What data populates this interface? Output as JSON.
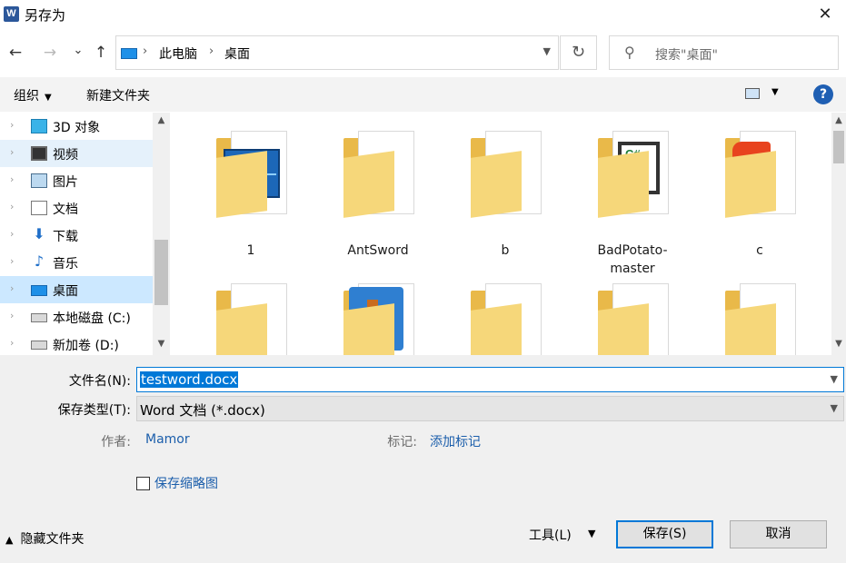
{
  "window": {
    "title": "另存为",
    "app_icon": "word-icon",
    "close": "✕"
  },
  "nav": {
    "back": "←",
    "forward": "→",
    "recent": "⌄",
    "up": "↑",
    "breadcrumb": [
      "此电脑",
      "桌面"
    ],
    "refresh": "↻",
    "search_placeholder": "搜索\"桌面\""
  },
  "toolbar": {
    "organize": "组织",
    "new_folder": "新建文件夹",
    "help": "?"
  },
  "tree": [
    {
      "label": "3D 对象",
      "icon": "cube-3d-icon",
      "state": ""
    },
    {
      "label": "视频",
      "icon": "video-icon",
      "state": "hover"
    },
    {
      "label": "图片",
      "icon": "pictures-icon",
      "state": ""
    },
    {
      "label": "文档",
      "icon": "documents-icon",
      "state": ""
    },
    {
      "label": "下载",
      "icon": "download-icon",
      "state": ""
    },
    {
      "label": "音乐",
      "icon": "music-icon",
      "state": ""
    },
    {
      "label": "桌面",
      "icon": "desktop-icon",
      "state": "sel"
    },
    {
      "label": "本地磁盘 (C:)",
      "icon": "drive-c-icon",
      "state": ""
    },
    {
      "label": "新加卷 (D:)",
      "icon": "drive-d-icon",
      "state": ""
    }
  ],
  "folders": [
    {
      "name": "1",
      "icon": "folder-chart-icon"
    },
    {
      "name": "AntSword",
      "icon": "folder-docs-icon"
    },
    {
      "name": "b",
      "icon": "folder-docs-icon"
    },
    {
      "name": "BadPotato-master",
      "icon": "folder-csharp-icon"
    },
    {
      "name": "c",
      "icon": "folder-puzzle-icon"
    },
    {
      "name": "",
      "icon": "folder-docs-icon"
    },
    {
      "name": "",
      "icon": "folder-app-icon"
    },
    {
      "name": "",
      "icon": "folder-docs-icon"
    },
    {
      "name": "",
      "icon": "folder-java-icon"
    },
    {
      "name": "",
      "icon": "folder-docs-icon"
    }
  ],
  "form": {
    "filename_label": "文件名(N):",
    "filename_value": "testword.docx",
    "filetype_label": "保存类型(T):",
    "filetype_value": "Word 文档 (*.docx)",
    "author_label": "作者:",
    "author_value": "Mamor",
    "tags_label": "标记:",
    "tags_value": "添加标记",
    "thumbnail_label": "保存缩略图",
    "thumbnail_checked": false,
    "hide_folders": "隐藏文件夹",
    "tools": "工具(L)",
    "save": "保存(S)",
    "cancel": "取消"
  },
  "colors": {
    "accent": "#0078d7",
    "folder": "#e9b949",
    "link": "#1b5eab",
    "selection": "#cce8ff"
  }
}
